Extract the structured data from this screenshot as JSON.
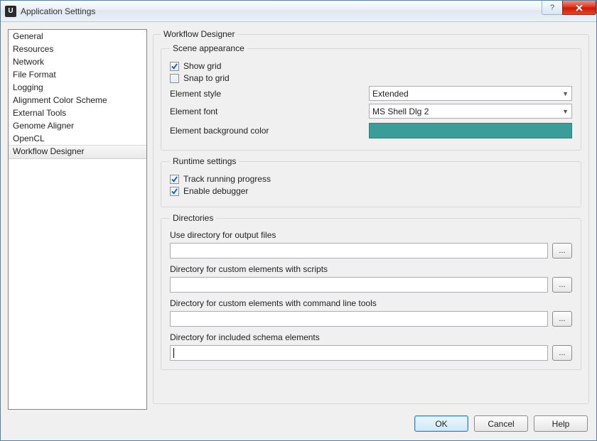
{
  "window": {
    "title": "Application Settings",
    "icon_letter": "U"
  },
  "sidebar": {
    "items": [
      "General",
      "Resources",
      "Network",
      "File Format",
      "Logging",
      "Alignment Color Scheme",
      "External Tools",
      "Genome Aligner",
      "OpenCL",
      "Workflow Designer"
    ],
    "selected_index": 9
  },
  "main": {
    "group_title": "Workflow Designer",
    "scene": {
      "legend": "Scene appearance",
      "show_grid_label": "Show grid",
      "show_grid_checked": true,
      "snap_label": "Snap to grid",
      "snap_checked": false,
      "style_label": "Element style",
      "style_value": "Extended",
      "font_label": "Element font",
      "font_value": "MS Shell Dlg 2",
      "bgcolor_label": "Element background color",
      "bgcolor_hex": "#3a9d98"
    },
    "runtime": {
      "legend": "Runtime settings",
      "track_label": "Track running progress",
      "track_checked": true,
      "debug_label": "Enable debugger",
      "debug_checked": true
    },
    "dirs": {
      "legend": "Directories",
      "output_label": "Use directory for output files",
      "output_value": "",
      "scripts_label": "Directory for custom elements with scripts",
      "scripts_value": "",
      "cmdline_label": "Directory for custom elements with command line tools",
      "cmdline_value": "",
      "schema_label": "Directory for included schema elements",
      "schema_value": "",
      "browse_label": "..."
    }
  },
  "buttons": {
    "ok": "OK",
    "cancel": "Cancel",
    "help": "Help"
  }
}
